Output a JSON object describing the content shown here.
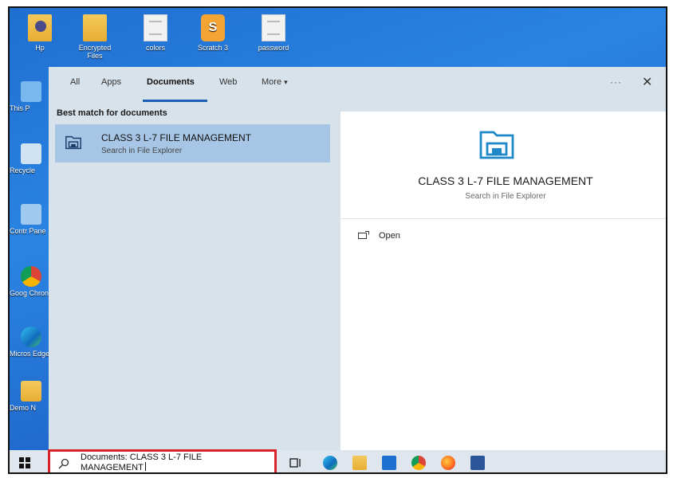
{
  "desktop": {
    "top_icons": [
      {
        "label": "Hp",
        "icon": "user-folder-icon"
      },
      {
        "label": "Encrypted Files",
        "icon": "folder-icon"
      },
      {
        "label": "colors",
        "icon": "document-icon"
      },
      {
        "label": "Scratch 3",
        "icon": "scratch-icon"
      },
      {
        "label": "password",
        "icon": "document-icon"
      }
    ],
    "left_icons": [
      {
        "label": "This P",
        "icon": "this-pc-icon"
      },
      {
        "label": "Recycle",
        "icon": "recycle-bin-icon"
      },
      {
        "label": "Contr Pane",
        "icon": "control-panel-icon"
      },
      {
        "label": "Goog Chron",
        "icon": "chrome-icon"
      },
      {
        "label": "Micros Edge",
        "icon": "edge-icon"
      },
      {
        "label": "Demo N",
        "icon": "folder-icon"
      }
    ]
  },
  "search": {
    "tabs": [
      {
        "label": "All"
      },
      {
        "label": "Apps"
      },
      {
        "label": "Documents",
        "active": true
      },
      {
        "label": "Web"
      },
      {
        "label": "More"
      }
    ],
    "more_caret": "▾",
    "ellipsis": "···",
    "close": "✕",
    "results_header": "Best match for documents",
    "result": {
      "title": "CLASS 3 L-7 FILE MANAGEMENT",
      "subtitle": "Search in File Explorer"
    },
    "preview": {
      "title": "CLASS 3 L-7 FILE MANAGEMENT",
      "subtitle": "Search in File Explorer",
      "actions": [
        {
          "label": "Open",
          "icon": "open-icon"
        }
      ]
    }
  },
  "taskbar": {
    "search_text_line1": "Documents: CLASS 3 L-7 FILE",
    "search_text_line2": "MANAGEMENT",
    "pinned": [
      "task-view-icon",
      "edge-icon",
      "file-explorer-icon",
      "mail-icon",
      "chrome-icon",
      "firefox-icon",
      "word-icon"
    ]
  },
  "colors": {
    "accent": "#1a5fb4",
    "selection": "#a7c6e6",
    "highlight_box": "#d8232a"
  }
}
